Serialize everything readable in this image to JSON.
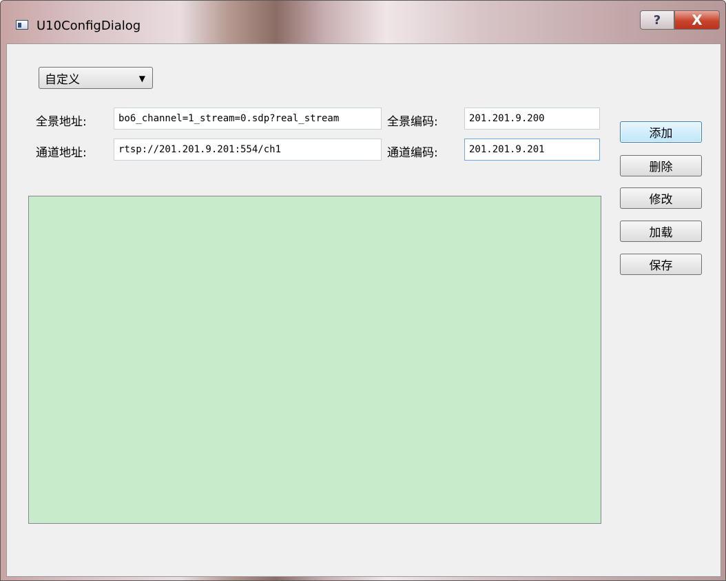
{
  "window": {
    "title": "U10ConfigDialog",
    "help_glyph": "?",
    "close_glyph": "X"
  },
  "mode_select": {
    "selected": "自定义",
    "arrow_glyph": "▼"
  },
  "form": {
    "panorama_address_label": "全景地址:",
    "panorama_address_value": "bo6_channel=1_stream=0.sdp?real_stream",
    "panorama_code_label": "全景编码:",
    "panorama_code_value": "201.201.9.200",
    "channel_address_label": "通道地址:",
    "channel_address_value": "rtsp://201.201.9.201:554/ch1",
    "channel_code_label": "通道编码:",
    "channel_code_value": "201.201.9.201"
  },
  "buttons": {
    "add": "添加",
    "delete": "删除",
    "modify": "修改",
    "load": "加载",
    "save": "保存"
  },
  "list_panel": {
    "background_color": "#c7ebcb"
  }
}
